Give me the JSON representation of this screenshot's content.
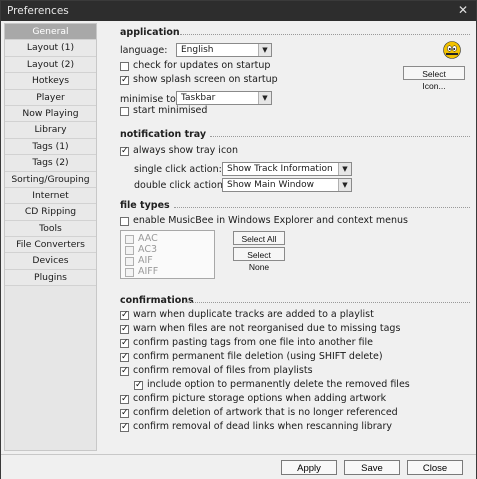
{
  "window": {
    "title": "Preferences",
    "close_glyph": "✕"
  },
  "sidebar": {
    "items": [
      {
        "label": "General",
        "active": true
      },
      {
        "label": "Layout (1)"
      },
      {
        "label": "Layout (2)"
      },
      {
        "label": "Hotkeys"
      },
      {
        "label": "Player"
      },
      {
        "label": "Now Playing"
      },
      {
        "label": "Library"
      },
      {
        "label": "Tags (1)"
      },
      {
        "label": "Tags (2)"
      },
      {
        "label": "Sorting/Grouping"
      },
      {
        "label": "Internet"
      },
      {
        "label": "CD Ripping"
      },
      {
        "label": "Tools"
      },
      {
        "label": "File Converters"
      },
      {
        "label": "Devices"
      },
      {
        "label": "Plugins"
      }
    ]
  },
  "application": {
    "heading": "application",
    "language_label": "language:",
    "language_value": "English",
    "check_updates": {
      "label": "check for updates on startup",
      "checked": false
    },
    "splash": {
      "label": "show splash screen on startup",
      "checked": true
    },
    "select_icon_label": "Select Icon...",
    "minimise_label": "minimise to:",
    "minimise_value": "Taskbar",
    "start_minimised": {
      "label": "start minimised",
      "checked": false
    }
  },
  "notification": {
    "heading": "notification tray",
    "always_show": {
      "label": "always show tray icon",
      "checked": true
    },
    "single_label": "single click action:",
    "single_value": "Show Track Information",
    "double_label": "double click action:",
    "double_value": "Show Main Window"
  },
  "filetypes": {
    "heading": "file types",
    "enable": {
      "label": "enable MusicBee in Windows Explorer and context menus",
      "checked": false
    },
    "items": [
      "AAC",
      "AC3",
      "AIF",
      "AIFF"
    ],
    "select_all": "Select All",
    "select_none": "Select None"
  },
  "confirmations": {
    "heading": "confirmations",
    "items": [
      {
        "label": "warn when duplicate tracks are added to a playlist",
        "checked": true
      },
      {
        "label": "warn when files are not reorganised due to missing tags",
        "checked": true
      },
      {
        "label": "confirm pasting tags from one file into another file",
        "checked": true
      },
      {
        "label": "confirm permanent file deletion (using SHIFT delete)",
        "checked": true
      },
      {
        "label": "confirm removal of files from playlists",
        "checked": true
      },
      {
        "label": "include option to permanently delete the removed files",
        "checked": true
      },
      {
        "label": "confirm picture storage options when adding artwork",
        "checked": true
      },
      {
        "label": "confirm deletion of artwork that is no longer referenced",
        "checked": true
      },
      {
        "label": "confirm removal of dead links when rescanning library",
        "checked": true
      }
    ]
  },
  "footer": {
    "apply": "Apply",
    "save": "Save",
    "close": "Close"
  },
  "glyphs": {
    "check": "✓",
    "arrow": "▼"
  }
}
